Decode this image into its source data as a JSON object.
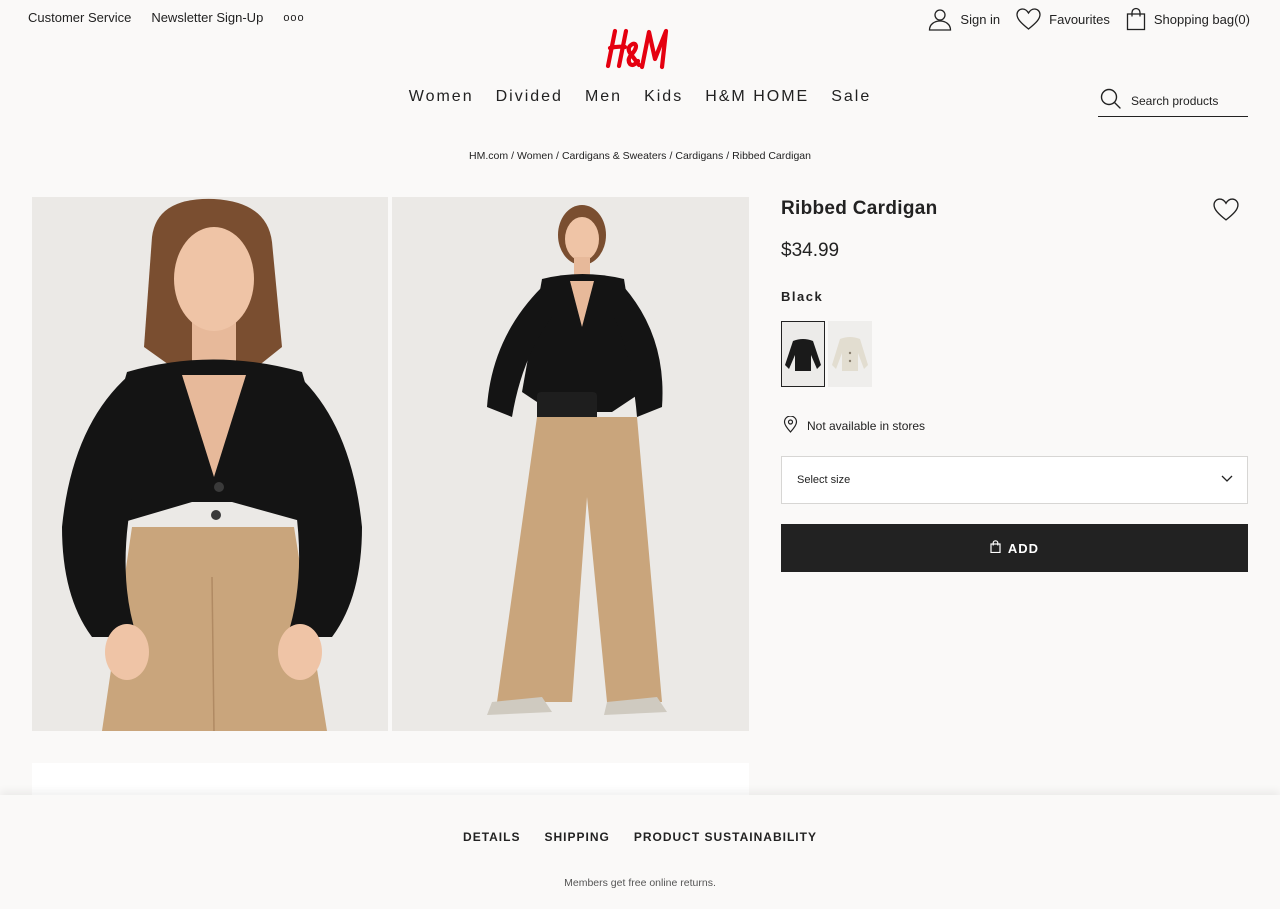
{
  "utility": {
    "customer_service": "Customer Service",
    "newsletter": "Newsletter Sign-Up",
    "more": "ooo",
    "sign_in": "Sign in",
    "favourites": "Favourites",
    "shopping_bag": "Shopping bag(0)"
  },
  "logo": {
    "text": "H&M",
    "color": "#e50010"
  },
  "nav": {
    "items": [
      "Women",
      "Divided",
      "Men",
      "Kids",
      "H&M HOME",
      "Sale"
    ]
  },
  "search": {
    "placeholder": "Search products"
  },
  "breadcrumb": [
    "HM.com",
    "Women",
    "Cardigans & Sweaters",
    "Cardigans",
    "Ribbed Cardigan"
  ],
  "product": {
    "title": "Ribbed Cardigan",
    "price": "$34.99",
    "color_name": "Black",
    "swatches": [
      {
        "name": "Black",
        "color": "#1a1a1a",
        "selected": true
      },
      {
        "name": "Light beige",
        "color": "#e2ddd0",
        "selected": false
      }
    ],
    "store_availability": "Not available in stores",
    "size_select_placeholder": "Select size",
    "add_label": "ADD"
  },
  "bottom": {
    "tabs": [
      "DETAILS",
      "SHIPPING",
      "PRODUCT SUSTAINABILITY"
    ],
    "returns_note": "Members get free online returns."
  },
  "icons": {
    "user": "user-icon",
    "heart": "heart-icon",
    "bag": "bag-icon",
    "search": "search-icon",
    "location": "location-pin-icon",
    "chevron": "chevron-down-icon"
  }
}
